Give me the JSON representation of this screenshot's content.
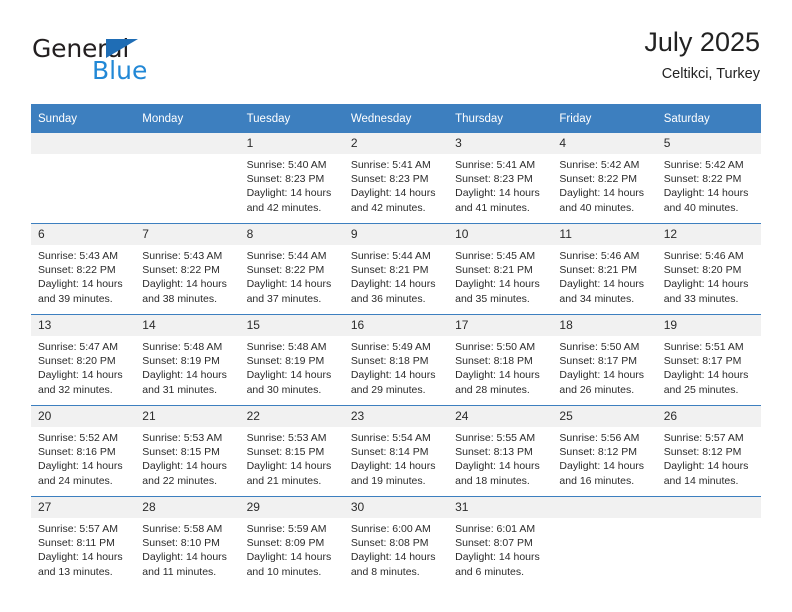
{
  "brand": {
    "name_primary": "General",
    "name_secondary": "Blue"
  },
  "header": {
    "title": "July 2025",
    "subtitle": "Celtikci, Turkey"
  },
  "colors": {
    "header_blue": "#3d7fbf",
    "brand_blue": "#2288d6",
    "daynum_bg": "#f1f1f1"
  },
  "weekdays": [
    "Sunday",
    "Monday",
    "Tuesday",
    "Wednesday",
    "Thursday",
    "Friday",
    "Saturday"
  ],
  "weeks": [
    [
      {
        "day": "",
        "empty": true
      },
      {
        "day": "",
        "empty": true
      },
      {
        "day": "1",
        "sunrise": "Sunrise: 5:40 AM",
        "sunset": "Sunset: 8:23 PM",
        "daylight1": "Daylight: 14 hours",
        "daylight2": "and 42 minutes."
      },
      {
        "day": "2",
        "sunrise": "Sunrise: 5:41 AM",
        "sunset": "Sunset: 8:23 PM",
        "daylight1": "Daylight: 14 hours",
        "daylight2": "and 42 minutes."
      },
      {
        "day": "3",
        "sunrise": "Sunrise: 5:41 AM",
        "sunset": "Sunset: 8:23 PM",
        "daylight1": "Daylight: 14 hours",
        "daylight2": "and 41 minutes."
      },
      {
        "day": "4",
        "sunrise": "Sunrise: 5:42 AM",
        "sunset": "Sunset: 8:22 PM",
        "daylight1": "Daylight: 14 hours",
        "daylight2": "and 40 minutes."
      },
      {
        "day": "5",
        "sunrise": "Sunrise: 5:42 AM",
        "sunset": "Sunset: 8:22 PM",
        "daylight1": "Daylight: 14 hours",
        "daylight2": "and 40 minutes."
      }
    ],
    [
      {
        "day": "6",
        "sunrise": "Sunrise: 5:43 AM",
        "sunset": "Sunset: 8:22 PM",
        "daylight1": "Daylight: 14 hours",
        "daylight2": "and 39 minutes."
      },
      {
        "day": "7",
        "sunrise": "Sunrise: 5:43 AM",
        "sunset": "Sunset: 8:22 PM",
        "daylight1": "Daylight: 14 hours",
        "daylight2": "and 38 minutes."
      },
      {
        "day": "8",
        "sunrise": "Sunrise: 5:44 AM",
        "sunset": "Sunset: 8:22 PM",
        "daylight1": "Daylight: 14 hours",
        "daylight2": "and 37 minutes."
      },
      {
        "day": "9",
        "sunrise": "Sunrise: 5:44 AM",
        "sunset": "Sunset: 8:21 PM",
        "daylight1": "Daylight: 14 hours",
        "daylight2": "and 36 minutes."
      },
      {
        "day": "10",
        "sunrise": "Sunrise: 5:45 AM",
        "sunset": "Sunset: 8:21 PM",
        "daylight1": "Daylight: 14 hours",
        "daylight2": "and 35 minutes."
      },
      {
        "day": "11",
        "sunrise": "Sunrise: 5:46 AM",
        "sunset": "Sunset: 8:21 PM",
        "daylight1": "Daylight: 14 hours",
        "daylight2": "and 34 minutes."
      },
      {
        "day": "12",
        "sunrise": "Sunrise: 5:46 AM",
        "sunset": "Sunset: 8:20 PM",
        "daylight1": "Daylight: 14 hours",
        "daylight2": "and 33 minutes."
      }
    ],
    [
      {
        "day": "13",
        "sunrise": "Sunrise: 5:47 AM",
        "sunset": "Sunset: 8:20 PM",
        "daylight1": "Daylight: 14 hours",
        "daylight2": "and 32 minutes."
      },
      {
        "day": "14",
        "sunrise": "Sunrise: 5:48 AM",
        "sunset": "Sunset: 8:19 PM",
        "daylight1": "Daylight: 14 hours",
        "daylight2": "and 31 minutes."
      },
      {
        "day": "15",
        "sunrise": "Sunrise: 5:48 AM",
        "sunset": "Sunset: 8:19 PM",
        "daylight1": "Daylight: 14 hours",
        "daylight2": "and 30 minutes."
      },
      {
        "day": "16",
        "sunrise": "Sunrise: 5:49 AM",
        "sunset": "Sunset: 8:18 PM",
        "daylight1": "Daylight: 14 hours",
        "daylight2": "and 29 minutes."
      },
      {
        "day": "17",
        "sunrise": "Sunrise: 5:50 AM",
        "sunset": "Sunset: 8:18 PM",
        "daylight1": "Daylight: 14 hours",
        "daylight2": "and 28 minutes."
      },
      {
        "day": "18",
        "sunrise": "Sunrise: 5:50 AM",
        "sunset": "Sunset: 8:17 PM",
        "daylight1": "Daylight: 14 hours",
        "daylight2": "and 26 minutes."
      },
      {
        "day": "19",
        "sunrise": "Sunrise: 5:51 AM",
        "sunset": "Sunset: 8:17 PM",
        "daylight1": "Daylight: 14 hours",
        "daylight2": "and 25 minutes."
      }
    ],
    [
      {
        "day": "20",
        "sunrise": "Sunrise: 5:52 AM",
        "sunset": "Sunset: 8:16 PM",
        "daylight1": "Daylight: 14 hours",
        "daylight2": "and 24 minutes."
      },
      {
        "day": "21",
        "sunrise": "Sunrise: 5:53 AM",
        "sunset": "Sunset: 8:15 PM",
        "daylight1": "Daylight: 14 hours",
        "daylight2": "and 22 minutes."
      },
      {
        "day": "22",
        "sunrise": "Sunrise: 5:53 AM",
        "sunset": "Sunset: 8:15 PM",
        "daylight1": "Daylight: 14 hours",
        "daylight2": "and 21 minutes."
      },
      {
        "day": "23",
        "sunrise": "Sunrise: 5:54 AM",
        "sunset": "Sunset: 8:14 PM",
        "daylight1": "Daylight: 14 hours",
        "daylight2": "and 19 minutes."
      },
      {
        "day": "24",
        "sunrise": "Sunrise: 5:55 AM",
        "sunset": "Sunset: 8:13 PM",
        "daylight1": "Daylight: 14 hours",
        "daylight2": "and 18 minutes."
      },
      {
        "day": "25",
        "sunrise": "Sunrise: 5:56 AM",
        "sunset": "Sunset: 8:12 PM",
        "daylight1": "Daylight: 14 hours",
        "daylight2": "and 16 minutes."
      },
      {
        "day": "26",
        "sunrise": "Sunrise: 5:57 AM",
        "sunset": "Sunset: 8:12 PM",
        "daylight1": "Daylight: 14 hours",
        "daylight2": "and 14 minutes."
      }
    ],
    [
      {
        "day": "27",
        "sunrise": "Sunrise: 5:57 AM",
        "sunset": "Sunset: 8:11 PM",
        "daylight1": "Daylight: 14 hours",
        "daylight2": "and 13 minutes."
      },
      {
        "day": "28",
        "sunrise": "Sunrise: 5:58 AM",
        "sunset": "Sunset: 8:10 PM",
        "daylight1": "Daylight: 14 hours",
        "daylight2": "and 11 minutes."
      },
      {
        "day": "29",
        "sunrise": "Sunrise: 5:59 AM",
        "sunset": "Sunset: 8:09 PM",
        "daylight1": "Daylight: 14 hours",
        "daylight2": "and 10 minutes."
      },
      {
        "day": "30",
        "sunrise": "Sunrise: 6:00 AM",
        "sunset": "Sunset: 8:08 PM",
        "daylight1": "Daylight: 14 hours",
        "daylight2": "and 8 minutes."
      },
      {
        "day": "31",
        "sunrise": "Sunrise: 6:01 AM",
        "sunset": "Sunset: 8:07 PM",
        "daylight1": "Daylight: 14 hours",
        "daylight2": "and 6 minutes."
      },
      {
        "day": "",
        "empty": true
      },
      {
        "day": "",
        "empty": true
      }
    ]
  ]
}
